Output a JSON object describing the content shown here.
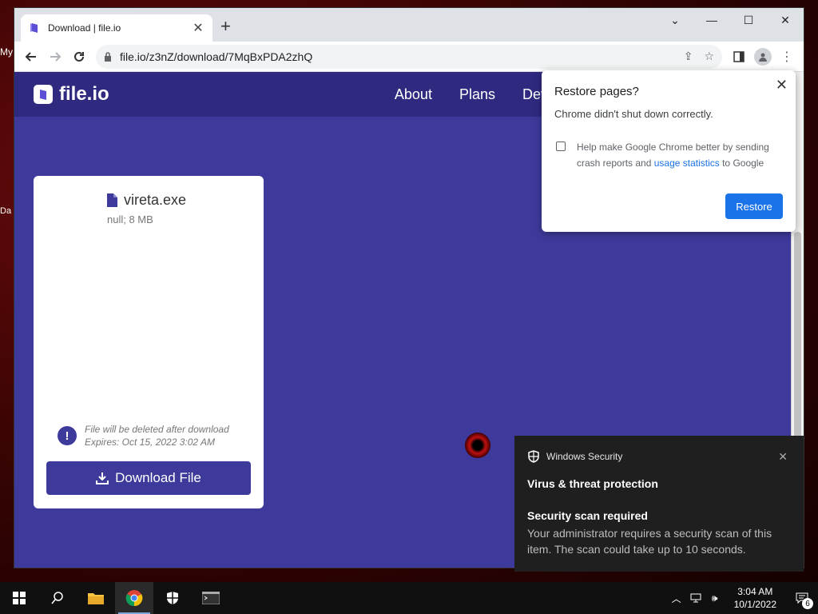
{
  "desktop": {
    "frag1": "My",
    "frag2": "Da"
  },
  "browser": {
    "tab_title": "Download | file.io",
    "url": "file.io/z3nZ/download/7MqBxPDA2zhQ"
  },
  "site": {
    "logo_text": "file.io",
    "nav": [
      "About",
      "Plans",
      "Dev"
    ]
  },
  "file_card": {
    "filename": "vireta.exe",
    "meta": "null; 8 MB",
    "notice_line1": "File will be deleted after download",
    "notice_line2": "Expires: Oct 15, 2022 3:02 AM",
    "download_label": "Download File"
  },
  "restore_popup": {
    "title": "Restore pages?",
    "subtitle": "Chrome didn't shut down correctly.",
    "checkbox_text_before": "Help make Google Chrome better by sending crash reports and ",
    "checkbox_link": "usage statistics",
    "checkbox_text_after": " to Google",
    "button_label": "Restore"
  },
  "toast": {
    "app_name": "Windows Security",
    "heading": "Virus & threat protection",
    "title": "Security scan required",
    "body": "Your administrator requires a security scan of this item. The scan could take up to 10 seconds."
  },
  "taskbar": {
    "time": "3:04 AM",
    "date": "10/1/2022",
    "notification_count": "6"
  }
}
